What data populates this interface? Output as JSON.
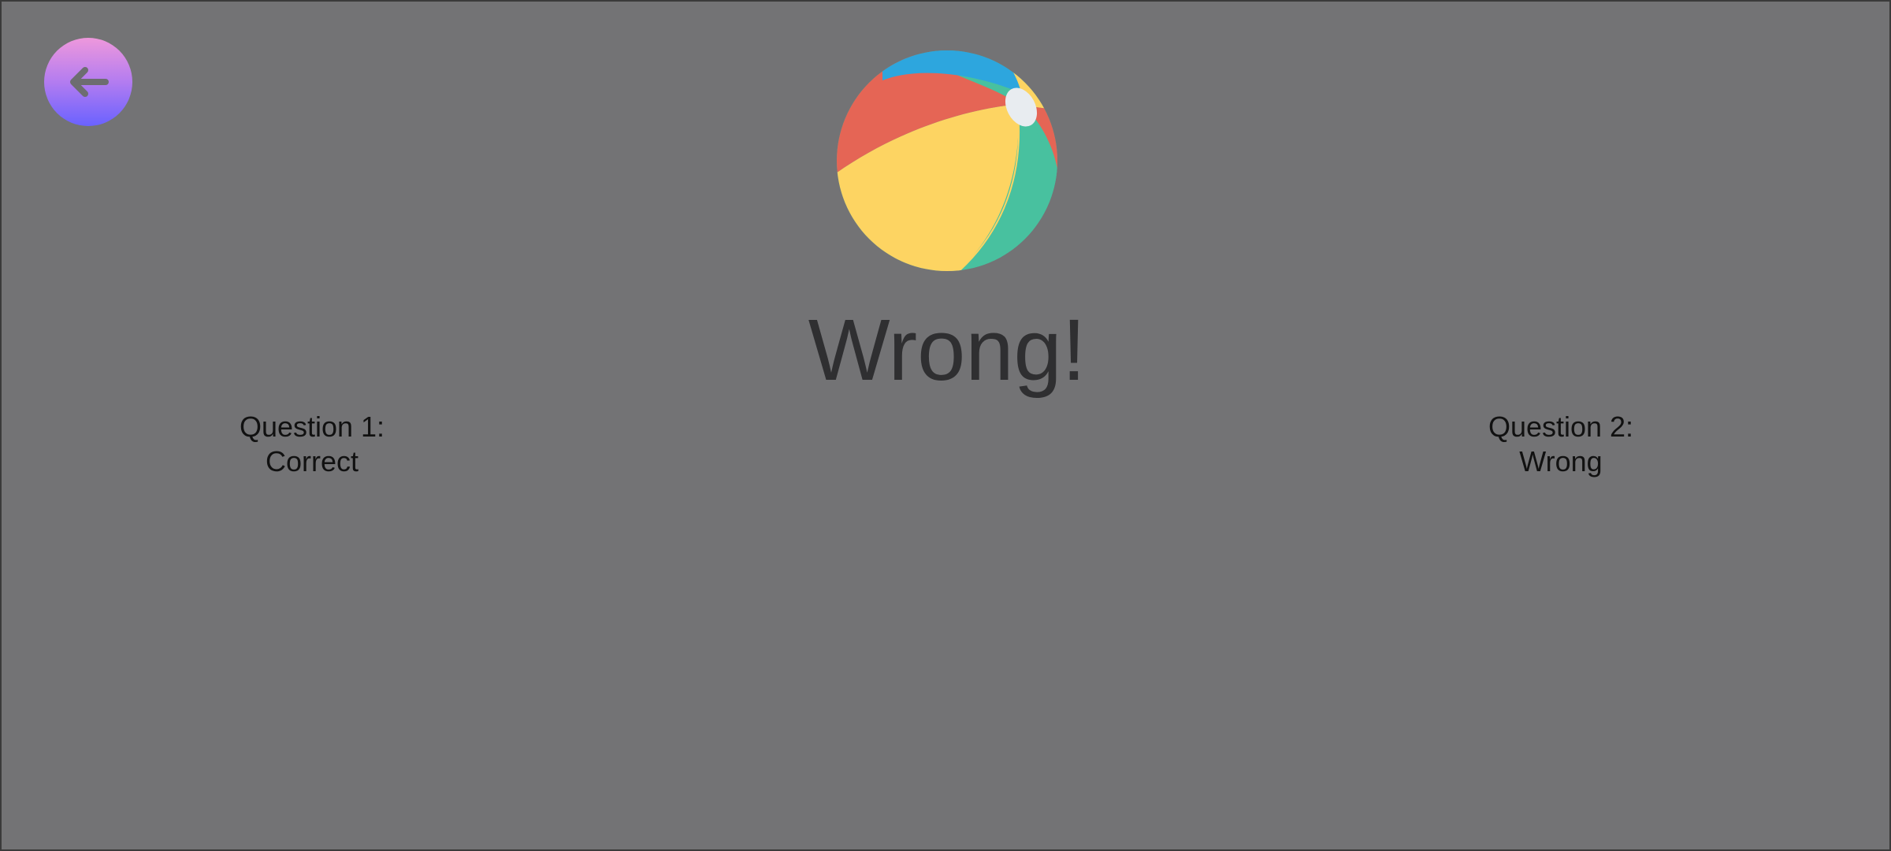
{
  "nav": {
    "back_icon": "arrow-left-icon",
    "back_color": "#6d6d70"
  },
  "result": {
    "title": "Wrong!",
    "icon": "beach-ball-icon"
  },
  "questions": [
    {
      "label": "Question 1:",
      "status": "Correct"
    },
    {
      "label": "Question 2:",
      "status": "Wrong"
    }
  ],
  "colors": {
    "background": "#737375",
    "title": "#2f2f31",
    "text": "#111111",
    "ball_red": "#e56555",
    "ball_yellow": "#fdd462",
    "ball_blue": "#2da6de",
    "ball_green": "#48c19f",
    "ball_cap": "#e8ecf0"
  }
}
